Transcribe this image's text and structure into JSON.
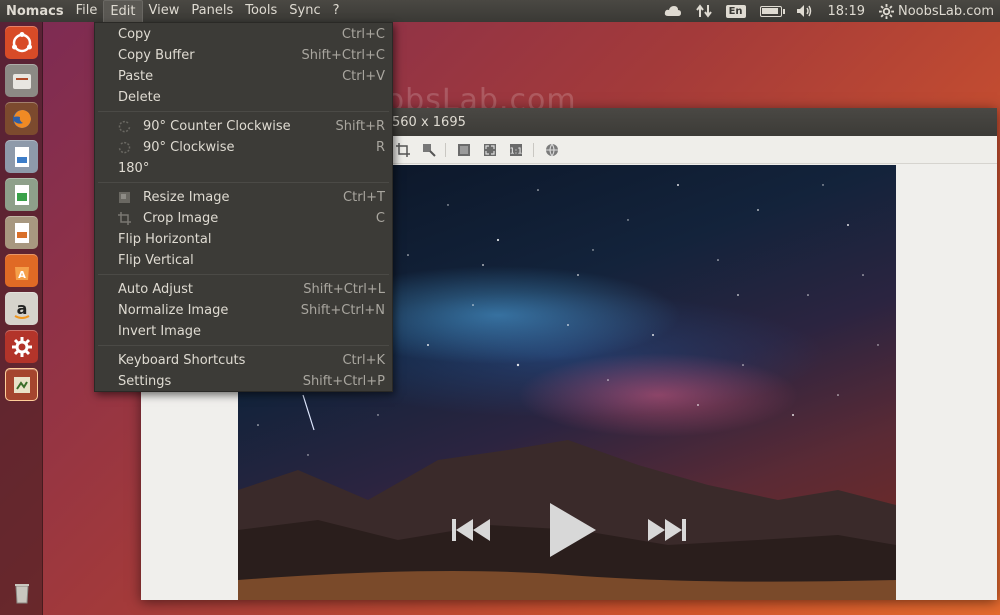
{
  "top_panel": {
    "app_name": "Nomacs",
    "menus": [
      "File",
      "Edit",
      "View",
      "Panels",
      "Tools",
      "Sync",
      "?"
    ],
    "active_menu": "Edit",
    "language": "En",
    "time": "18:19",
    "session": "NoobsLab.com",
    "icons": [
      "cloud-icon",
      "network-arrows-icon",
      "battery-icon",
      "volume-icon",
      "gear-icon"
    ]
  },
  "watermark": "NoobsLab.com",
  "window": {
    "title": "560 x 1695"
  },
  "edit_menu": {
    "items": [
      {
        "label": "Copy",
        "shortcut": "Ctrl+C"
      },
      {
        "label": "Copy Buffer",
        "shortcut": "Shift+Ctrl+C"
      },
      {
        "label": "Paste",
        "shortcut": "Ctrl+V"
      },
      {
        "label": "Delete",
        "shortcut": ""
      },
      {
        "label": "90° Counter Clockwise",
        "shortcut": "Shift+R"
      },
      {
        "label": "90° Clockwise",
        "shortcut": "R"
      },
      {
        "label": "180°",
        "shortcut": ""
      },
      {
        "label": "Resize Image",
        "shortcut": "Ctrl+T"
      },
      {
        "label": "Crop Image",
        "shortcut": "C"
      },
      {
        "label": "Flip Horizontal",
        "shortcut": ""
      },
      {
        "label": "Flip Vertical",
        "shortcut": ""
      },
      {
        "label": "Auto Adjust",
        "shortcut": "Shift+Ctrl+L"
      },
      {
        "label": "Normalize Image",
        "shortcut": "Shift+Ctrl+N"
      },
      {
        "label": "Invert Image",
        "shortcut": ""
      },
      {
        "label": "Keyboard Shortcuts",
        "shortcut": "Ctrl+K"
      },
      {
        "label": "Settings",
        "shortcut": "Shift+Ctrl+P"
      }
    ]
  },
  "launcher": {
    "icons": [
      "ubuntu-dash-icon",
      "files-icon",
      "firefox-icon",
      "writer-icon",
      "calc-icon",
      "impress-icon",
      "software-center-icon",
      "amazon-icon",
      "system-settings-icon",
      "nomacs-icon",
      "trash-icon"
    ]
  },
  "media_controls": [
    "previous-icon",
    "play-icon",
    "next-icon"
  ],
  "colors": {
    "panel_bg": "#3c3b37",
    "menu_bg": "#3c3b37",
    "menu_text": "#dfdbd2",
    "accent": "#dd4814"
  }
}
